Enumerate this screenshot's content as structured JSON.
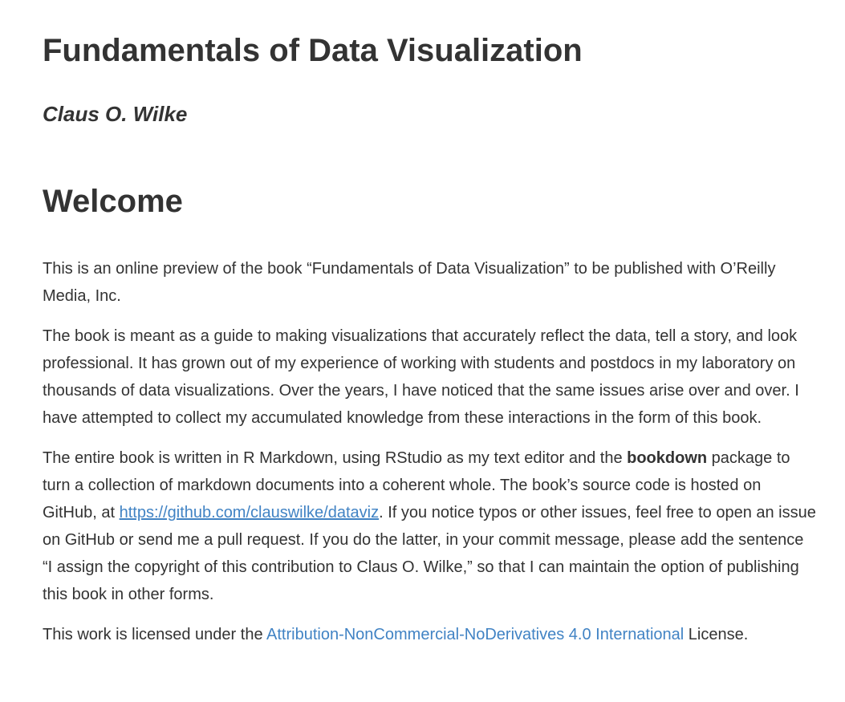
{
  "header": {
    "title": "Fundamentals of Data Visualization",
    "author": "Claus O. Wilke"
  },
  "section": {
    "title": "Welcome"
  },
  "paragraphs": {
    "p1": "This is an online preview of the book “Fundamentals of Data Visualization” to be published with O’Reilly Media, Inc.",
    "p2": "The book is meant as a guide to making visualizations that accurately reflect the data, tell a story, and look professional. It has grown out of my experience of working with students and postdocs in my laboratory on thousands of data visualizations. Over the years, I have noticed that the same issues arise over and over. I have attempted to collect my accumulated knowledge from these interactions in the form of this book.",
    "p3": {
      "before_bold": "The entire book is written in R Markdown, using RStudio as my text editor and the ",
      "bold": "bookdown",
      "after_bold": " package to turn a collection of markdown documents into a coherent whole. The book’s source code is hosted on GitHub, at ",
      "link": "https://github.com/clauswilke/dataviz",
      "after_link": ". If you notice typos or other issues, feel free to open an issue on GitHub or send me a pull request. If you do the latter, in your commit message, please add the sentence “I assign the copyright of this contribution to Claus O. Wilke,” so that I can maintain the option of publishing this book in other forms."
    },
    "p4": {
      "before_link": "This work is licensed under the ",
      "link": "Attribution-NonCommercial-NoDerivatives 4.0 International",
      "after_link": " License."
    }
  },
  "colors": {
    "text": "#333333",
    "link": "#4183c4",
    "background": "#ffffff"
  }
}
